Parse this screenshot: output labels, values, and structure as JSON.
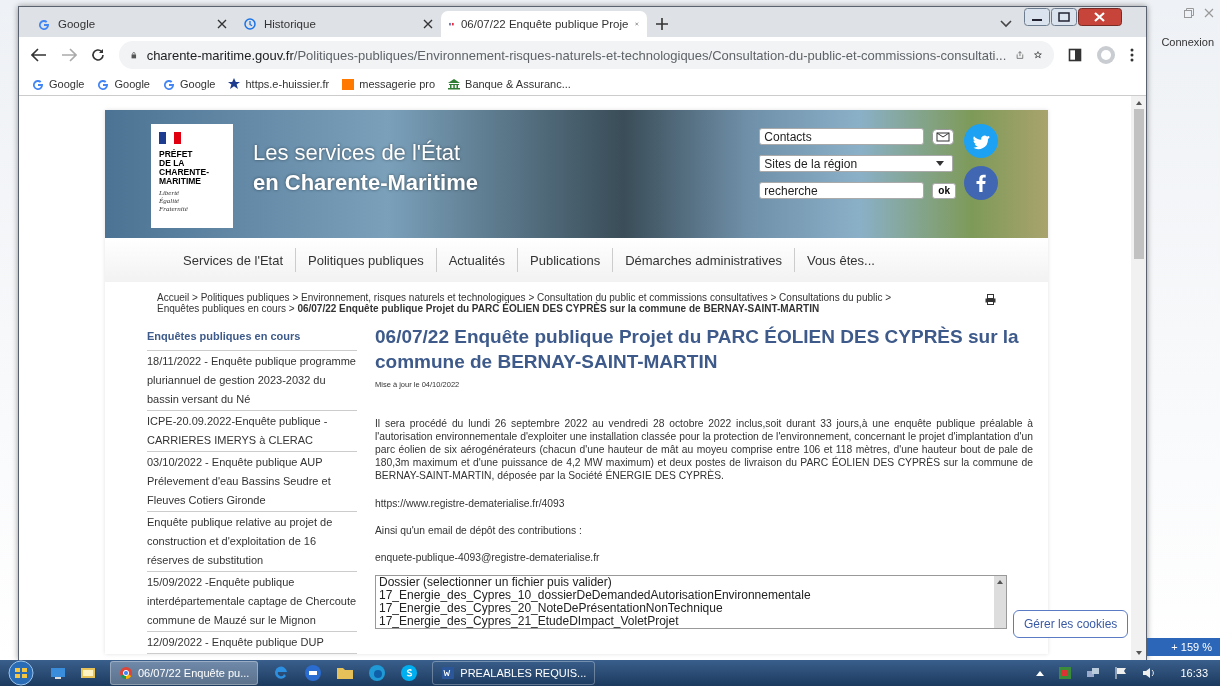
{
  "browser": {
    "tabs": [
      {
        "title": "Google",
        "selected": false
      },
      {
        "title": "Historique",
        "selected": false
      },
      {
        "title": "06/07/22 Enquête publique Proje",
        "selected": true
      }
    ],
    "url": "charente-maritime.gouv.fr/Politiques-publiques/Environnement-risques-naturels-et-technologiques/Consultation-du-public-et-commissions-consultati...",
    "bookmarks": [
      "Google",
      "Google",
      "Google",
      "https.e-huissier.fr",
      "messagerie pro",
      "Banque & Assuranc..."
    ]
  },
  "desktop": {
    "connexion": "Connexion",
    "zoom": "+ 159 %"
  },
  "site": {
    "logo_lines": [
      "PRÉFET",
      "DE LA",
      "CHARENTE-",
      "MARITIME"
    ],
    "motto": [
      "Liberté",
      "Égalité",
      "Fraternité"
    ],
    "title_line1": "Les services de l'État",
    "title_line2": "en Charente-Maritime",
    "contacts_field": "Contacts",
    "region_select": "Sites de la région",
    "search_placeholder": "recherche",
    "ok_button": "ok",
    "nav": [
      "Services de l'Etat",
      "Politiques publiques",
      "Actualités",
      "Publications",
      "Démarches administratives",
      "Vous êtes..."
    ],
    "breadcrumb": [
      {
        "label": "Accueil",
        "kind": "link"
      },
      {
        "label": ">",
        "kind": "sep"
      },
      {
        "label": "Politiques publiques",
        "kind": "link"
      },
      {
        "label": ">",
        "kind": "sep"
      },
      {
        "label": "Environnement, risques naturels et technologiques",
        "kind": "link"
      },
      {
        "label": ">",
        "kind": "sep"
      },
      {
        "label": "Consultation du public et commissions consultatives",
        "kind": "link"
      },
      {
        "label": ">",
        "kind": "sep"
      },
      {
        "label": "Consultations du public",
        "kind": "link"
      },
      {
        "label": ">",
        "kind": "sep"
      },
      {
        "label": "Enquêtes publiques en cours",
        "kind": "link"
      },
      {
        "label": ">",
        "kind": "sep"
      },
      {
        "label": "06/07/22 Enquête publique Projet du PARC ÉOLIEN DES CYPRÈS sur la commune de BERNAY-SAINT-MARTIN",
        "kind": "current"
      }
    ]
  },
  "sidebar": {
    "title": "Enquêtes publiques en cours",
    "items": [
      "18/11/2022 - Enquête publique programme pluriannuel de gestion 2023-2032 du bassin versant du Né",
      "ICPE-20.09.2022-Enquête publique - CARRIERES IMERYS à CLERAC",
      "03/10/2022 - Enquête publique AUP Prélevement d'eau Bassins Seudre et Fleuves Cotiers Gironde",
      "Enquête publique relative au projet de construction et d'exploitation de 16 réserves de substitution",
      "15/09/2022 -Enquête publique interdépartementale captage de Chercoute commune de Mauzé sur le Mignon",
      "12/09/2022 - Enquête publique DUP"
    ]
  },
  "article": {
    "title": "06/07/22 Enquête publique Projet du PARC ÉOLIEN DES CYPRÈS sur la commune de BERNAY-SAINT-MARTIN",
    "updated": "Mise à jour le 04/10/2022",
    "body": "Il sera procédé du lundi 26 septembre 2022 au vendredi 28 octobre 2022 inclus,soit durant 33 jours,à une enquête publique préalable à l'autorisation environnementale d'exploiter une installation classée pour la protection de l'environnement, concernant le projet d'implantation d'un parc éolien de six aérogénérateurs (chacun d'une hauteur de mât au moyeu comprise entre 106 et 118 mètres, d'une hauteur bout de pale de 180,3m maximum et d'une puissance de 4,2 MW maximum) et deux postes de livraison du PARC ÉOLIEN DES CYPRÈS sur la commune de BERNAY-SAINT-MARTIN, déposée par la Société ÉNERGIE DES CYPRÈS.",
    "register_url": "https://www.registre-dematerialise.fr/4093",
    "email_intro": "Ainsi qu'un email de dépôt des contributions :",
    "email": "enquete-publique-4093@registre-dematerialise.fr",
    "files_header": "Dossier (selectionner un fichier puis valider)",
    "files": [
      "17_Energie_des_Cypres_10_dossierDeDemandedAutorisationEnvironnementale",
      "17_Energie_des_Cypres_20_NoteDePrésentationNonTechnique",
      "17_Energie_des_Cypres_21_EtudeDImpact_VoletProjet"
    ]
  },
  "cookie_button": "Gérer les cookies",
  "taskbar": {
    "tasks": [
      {
        "label": "06/07/22 Enquête pu...",
        "selected": true
      },
      {
        "label": "PREALABLES REQUIS...",
        "selected": false
      }
    ],
    "clock": "16:33"
  }
}
